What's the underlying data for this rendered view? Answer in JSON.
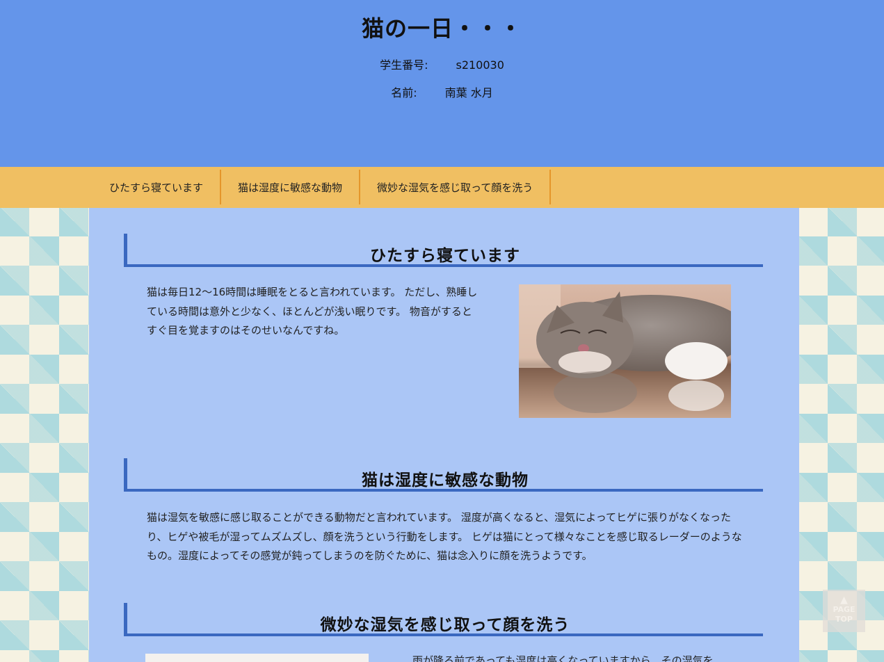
{
  "header": {
    "title": "猫の一日・・・",
    "student_id_label": "学生番号:",
    "student_id_value": "s210030",
    "name_label": "名前:",
    "name_value": "南葉 水月"
  },
  "nav": {
    "items": [
      {
        "label": "ひたすら寝ています"
      },
      {
        "label": "猫は湿度に敏感な動物"
      },
      {
        "label": "微妙な湿気を感じ取って顔を洗う"
      }
    ]
  },
  "sections": [
    {
      "heading": "ひたすら寝ています",
      "text": "猫は毎日12～16時間は睡眠をとると言われています。 ただし、熟睡している時間は意外と少なく、ほとんどが浅い眠りです。 物音がするとすぐ目を覚ますのはそのせいなんですね。"
    },
    {
      "heading": "猫は湿度に敏感な動物",
      "text": "猫は湿気を敏感に感じ取ることができる動物だと言われています。 湿度が高くなると、湿気によってヒゲに張りがなくなったり、ヒゲや被毛が湿ってムズムズし、顔を洗うという行動をします。 ヒゲは猫にとって様々なことを感じ取るレーダーのようなもの。湿度によってその感覚が鈍ってしまうのを防ぐために、猫は念入りに顔を洗うようです。"
    },
    {
      "heading": "微妙な湿気を感じ取って顔を洗う",
      "text": "雨が降る前であっても湿度は高くなっていますから、その湿気を"
    }
  ],
  "page_top": {
    "line1": "PAGE",
    "line2": "TOP"
  }
}
